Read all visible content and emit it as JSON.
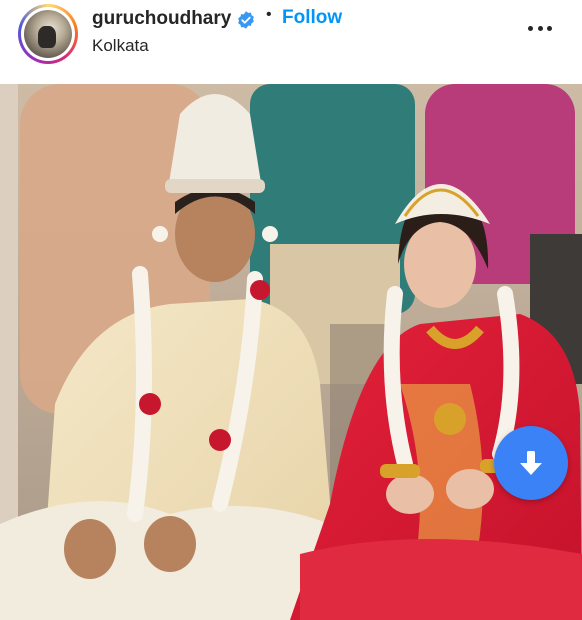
{
  "post_header": {
    "username": "guruchoudhary",
    "verified": true,
    "separator": "•",
    "follow_label": "Follow",
    "location": "Kolkata"
  },
  "icons": {
    "verified": "verified-badge-icon",
    "more": "more-options-icon",
    "download": "download-arrow-icon"
  },
  "colors": {
    "follow": "#0095f6",
    "verified": "#3897f0",
    "download_button": "#3b82f6",
    "text": "#262626"
  },
  "photo": {
    "alt": "Wedding photo of a bride and groom in traditional Bengali attire"
  }
}
